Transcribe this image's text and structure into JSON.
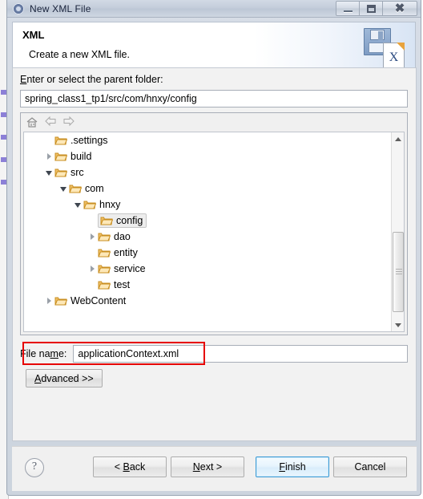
{
  "window": {
    "title": "New XML File",
    "app_icon": "gear-icon",
    "controls": {
      "minimize_label": "Minimize",
      "maximize_label": "Maximize",
      "close_label": "Close"
    }
  },
  "header": {
    "title": "XML",
    "description": "Create a new XML file.",
    "icon": "xml-file-save-icon"
  },
  "form": {
    "parent_folder_label": "Enter or select the parent folder:",
    "parent_folder_value": "spring_class1_tp1/src/com/hnxy/config",
    "parent_folder_placeholder": "",
    "file_name_label": "File name:",
    "file_name_value": "applicationContext.xml",
    "file_name_placeholder": "",
    "advanced_label": "Advanced >>"
  },
  "tree_toolbar": {
    "home_label": "Home",
    "back_label": "Back",
    "forward_label": "Forward"
  },
  "tree": {
    "items": [
      {
        "label": ".settings",
        "indent": 1,
        "twisty": "none",
        "selected": false
      },
      {
        "label": "build",
        "indent": 1,
        "twisty": "closed",
        "selected": false
      },
      {
        "label": "src",
        "indent": 1,
        "twisty": "open",
        "selected": false
      },
      {
        "label": "com",
        "indent": 2,
        "twisty": "open",
        "selected": false
      },
      {
        "label": "hnxy",
        "indent": 3,
        "twisty": "open",
        "selected": false
      },
      {
        "label": "config",
        "indent": 4,
        "twisty": "none",
        "selected": true
      },
      {
        "label": "dao",
        "indent": 4,
        "twisty": "closed",
        "selected": false
      },
      {
        "label": "entity",
        "indent": 4,
        "twisty": "none",
        "selected": false
      },
      {
        "label": "service",
        "indent": 4,
        "twisty": "closed",
        "selected": false
      },
      {
        "label": "test",
        "indent": 4,
        "twisty": "none",
        "selected": false
      },
      {
        "label": "WebContent",
        "indent": 1,
        "twisty": "closed",
        "selected": false
      }
    ]
  },
  "scrollbar": {
    "up_label": "Scroll up",
    "down_label": "Scroll down"
  },
  "footer": {
    "help_label": "?",
    "back_label": "< Back",
    "next_label": "Next >",
    "finish_label": "Finish",
    "cancel_label": "Cancel"
  },
  "annotation": {
    "highlight_color": "#e60000",
    "target": "file-name-row"
  },
  "colors": {
    "accent": "#3c9bd6",
    "folder": "#f0c066",
    "dialog_bg": "#f2f2f2",
    "titlebar": "#c7d0dc"
  }
}
